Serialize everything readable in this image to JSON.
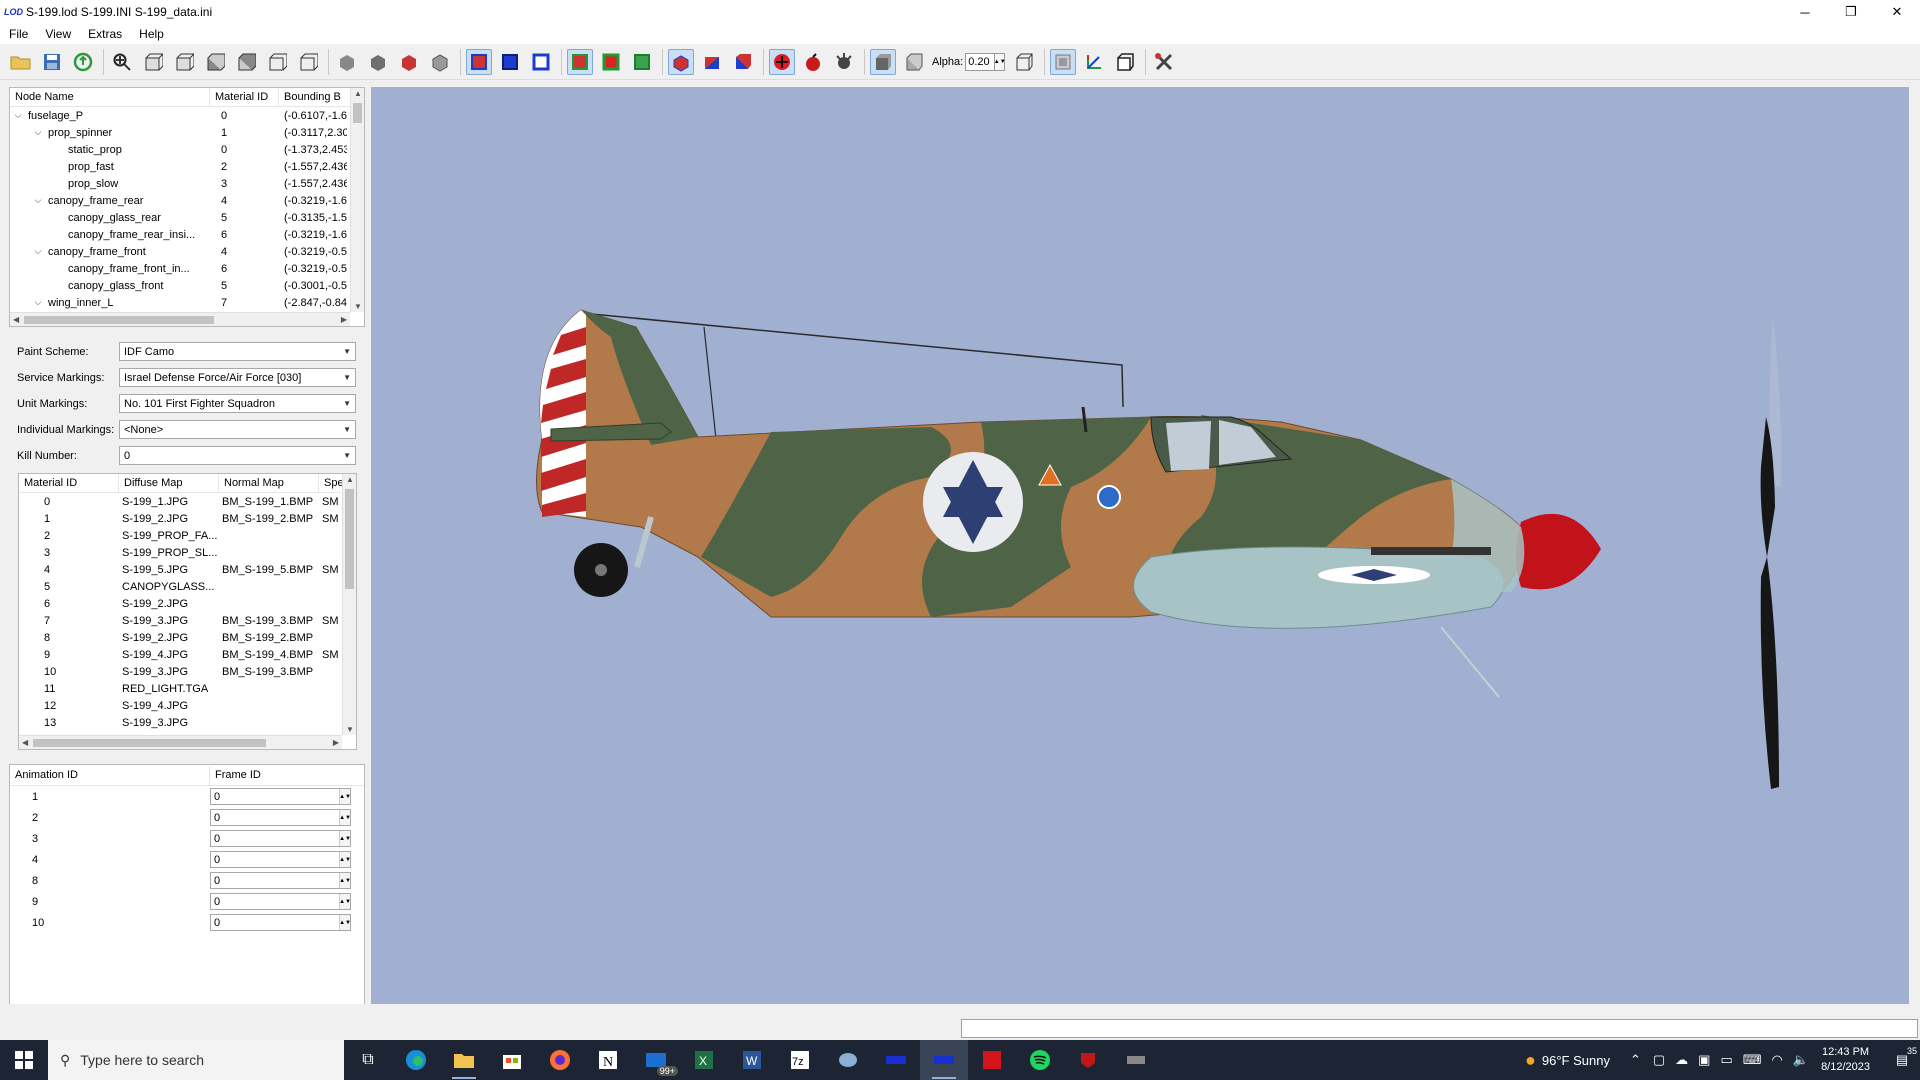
{
  "window": {
    "title": "S-199.lod  S-199.INI  S-199_data.ini",
    "app_icon": "LOD",
    "minimize": "─",
    "restore": "❐",
    "close": "✕"
  },
  "menu": [
    "File",
    "View",
    "Extras",
    "Help"
  ],
  "toolbar": {
    "alpha_label": "Alpha:",
    "alpha_value": "0.20"
  },
  "node_tree": {
    "headers": [
      "Node Name",
      "Material ID",
      "Bounding B"
    ],
    "rows": [
      {
        "indent": 0,
        "expand": "v",
        "name": "fuselage_P",
        "mat": "0",
        "bounds": "(-0.6107,-1.6"
      },
      {
        "indent": 1,
        "expand": "v",
        "name": "prop_spinner",
        "mat": "1",
        "bounds": "(-0.3117,2.30"
      },
      {
        "indent": 2,
        "expand": "",
        "name": "static_prop",
        "mat": "0",
        "bounds": "(-1.373,2.453"
      },
      {
        "indent": 2,
        "expand": "",
        "name": "prop_fast",
        "mat": "2",
        "bounds": "(-1.557,2.436"
      },
      {
        "indent": 2,
        "expand": "",
        "name": "prop_slow",
        "mat": "3",
        "bounds": "(-1.557,2.436"
      },
      {
        "indent": 1,
        "expand": "v",
        "name": "canopy_frame_rear",
        "mat": "4",
        "bounds": "(-0.3219,-1.6"
      },
      {
        "indent": 2,
        "expand": "",
        "name": "canopy_glass_rear",
        "mat": "5",
        "bounds": "(-0.3135,-1.5"
      },
      {
        "indent": 2,
        "expand": "",
        "name": "canopy_frame_rear_insi...",
        "mat": "6",
        "bounds": "(-0.3219,-1.6"
      },
      {
        "indent": 1,
        "expand": "v",
        "name": "canopy_frame_front",
        "mat": "4",
        "bounds": "(-0.3219,-0.5"
      },
      {
        "indent": 2,
        "expand": "",
        "name": "canopy_frame_front_in...",
        "mat": "6",
        "bounds": "(-0.3219,-0.5"
      },
      {
        "indent": 2,
        "expand": "",
        "name": "canopy_glass_front",
        "mat": "5",
        "bounds": "(-0.3001,-0.5"
      },
      {
        "indent": 1,
        "expand": "v",
        "name": "wing_inner_L",
        "mat": "7",
        "bounds": "(-2.847,-0.84"
      }
    ]
  },
  "form": {
    "paint_scheme": {
      "label": "Paint Scheme:",
      "value": "IDF Camo"
    },
    "service_markings": {
      "label": "Service Markings:",
      "value": "Israel Defense Force/Air Force [030]"
    },
    "unit_markings": {
      "label": "Unit Markings:",
      "value": "No. 101 First Fighter Squadron"
    },
    "individual_markings": {
      "label": "Individual Markings:",
      "value": "<None>"
    },
    "kill_number": {
      "label": "Kill Number:",
      "value": "0"
    }
  },
  "materials": {
    "headers": [
      "Material ID",
      "Diffuse Map",
      "Normal Map",
      "Spe"
    ],
    "rows": [
      [
        "0",
        "S-199_1.JPG",
        "BM_S-199_1.BMP",
        "SM"
      ],
      [
        "1",
        "S-199_2.JPG",
        "BM_S-199_2.BMP",
        "SM"
      ],
      [
        "2",
        "S-199_PROP_FA...",
        "",
        ""
      ],
      [
        "3",
        "S-199_PROP_SL...",
        "",
        ""
      ],
      [
        "4",
        "S-199_5.JPG",
        "BM_S-199_5.BMP",
        "SM"
      ],
      [
        "5",
        "CANOPYGLASS...",
        "",
        ""
      ],
      [
        "6",
        "S-199_2.JPG",
        "",
        ""
      ],
      [
        "7",
        "S-199_3.JPG",
        "BM_S-199_3.BMP",
        "SM"
      ],
      [
        "8",
        "S-199_2.JPG",
        "BM_S-199_2.BMP",
        ""
      ],
      [
        "9",
        "S-199_4.JPG",
        "BM_S-199_4.BMP",
        "SM"
      ],
      [
        "10",
        "S-199_3.JPG",
        "BM_S-199_3.BMP",
        ""
      ],
      [
        "11",
        "RED_LIGHT.TGA",
        "",
        ""
      ],
      [
        "12",
        "S-199_4.JPG",
        "",
        ""
      ],
      [
        "13",
        "S-199_3.JPG",
        "",
        ""
      ]
    ]
  },
  "animations": {
    "headers": [
      "Animation ID",
      "Frame ID"
    ],
    "rows": [
      {
        "id": "1",
        "frame": "0"
      },
      {
        "id": "2",
        "frame": "0"
      },
      {
        "id": "3",
        "frame": "0"
      },
      {
        "id": "4",
        "frame": "0"
      },
      {
        "id": "8",
        "frame": "0"
      },
      {
        "id": "9",
        "frame": "0"
      },
      {
        "id": "10",
        "frame": "0"
      }
    ]
  },
  "taskbar": {
    "search_placeholder": "Type here to search",
    "mail_badge": "99+",
    "weather": "96°F  Sunny",
    "time": "12:43 PM",
    "date": "8/12/2023",
    "notification_count": "35"
  },
  "colors": {
    "viewport_bg": "#a1afd0",
    "taskbar_bg": "#1d2535",
    "camo_tan": "#b27a4a",
    "camo_green": "#4f6446",
    "underside": "#a7c3c6",
    "spinner_red": "#c2131b",
    "roundel_blue": "#2e3f73"
  }
}
